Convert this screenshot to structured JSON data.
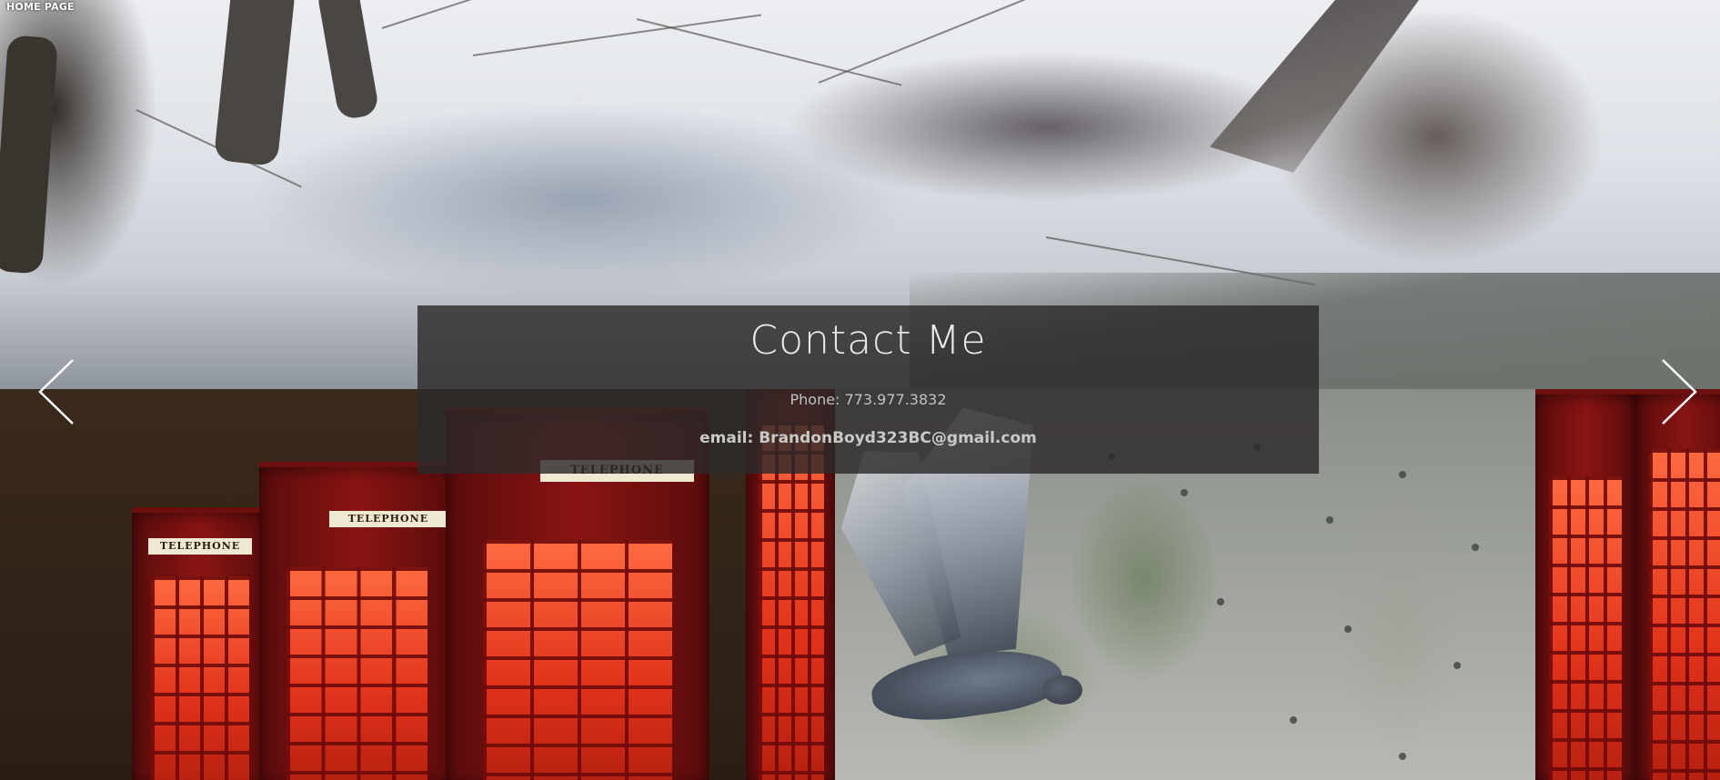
{
  "nav": {
    "home_label": "HOME PAGE"
  },
  "contact": {
    "title": "Contact Me",
    "phone": "Phone: 773.977.3832",
    "email": "email: BrandonBoyd323BC@gmail.com"
  },
  "booths": {
    "sign_label": "TELEPHONE"
  },
  "slideshow": {
    "prev_icon": "chevron-left-icon",
    "next_icon": "chevron-right-icon"
  },
  "colors": {
    "panel": "#2d2a2a",
    "title_text": "#e8ecea",
    "phone_text": "#bfc2c0",
    "email_text": "#c8cac8",
    "arrow": "#ffffff"
  }
}
